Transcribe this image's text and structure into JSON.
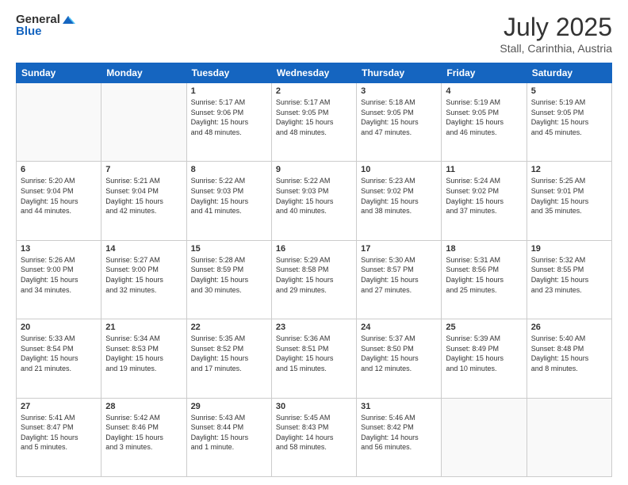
{
  "header": {
    "logo_general": "General",
    "logo_blue": "Blue",
    "month_year": "July 2025",
    "location": "Stall, Carinthia, Austria"
  },
  "weekdays": [
    "Sunday",
    "Monday",
    "Tuesday",
    "Wednesday",
    "Thursday",
    "Friday",
    "Saturday"
  ],
  "weeks": [
    [
      {
        "day": "",
        "info": ""
      },
      {
        "day": "",
        "info": ""
      },
      {
        "day": "1",
        "info": "Sunrise: 5:17 AM\nSunset: 9:06 PM\nDaylight: 15 hours\nand 48 minutes."
      },
      {
        "day": "2",
        "info": "Sunrise: 5:17 AM\nSunset: 9:05 PM\nDaylight: 15 hours\nand 48 minutes."
      },
      {
        "day": "3",
        "info": "Sunrise: 5:18 AM\nSunset: 9:05 PM\nDaylight: 15 hours\nand 47 minutes."
      },
      {
        "day": "4",
        "info": "Sunrise: 5:19 AM\nSunset: 9:05 PM\nDaylight: 15 hours\nand 46 minutes."
      },
      {
        "day": "5",
        "info": "Sunrise: 5:19 AM\nSunset: 9:05 PM\nDaylight: 15 hours\nand 45 minutes."
      }
    ],
    [
      {
        "day": "6",
        "info": "Sunrise: 5:20 AM\nSunset: 9:04 PM\nDaylight: 15 hours\nand 44 minutes."
      },
      {
        "day": "7",
        "info": "Sunrise: 5:21 AM\nSunset: 9:04 PM\nDaylight: 15 hours\nand 42 minutes."
      },
      {
        "day": "8",
        "info": "Sunrise: 5:22 AM\nSunset: 9:03 PM\nDaylight: 15 hours\nand 41 minutes."
      },
      {
        "day": "9",
        "info": "Sunrise: 5:22 AM\nSunset: 9:03 PM\nDaylight: 15 hours\nand 40 minutes."
      },
      {
        "day": "10",
        "info": "Sunrise: 5:23 AM\nSunset: 9:02 PM\nDaylight: 15 hours\nand 38 minutes."
      },
      {
        "day": "11",
        "info": "Sunrise: 5:24 AM\nSunset: 9:02 PM\nDaylight: 15 hours\nand 37 minutes."
      },
      {
        "day": "12",
        "info": "Sunrise: 5:25 AM\nSunset: 9:01 PM\nDaylight: 15 hours\nand 35 minutes."
      }
    ],
    [
      {
        "day": "13",
        "info": "Sunrise: 5:26 AM\nSunset: 9:00 PM\nDaylight: 15 hours\nand 34 minutes."
      },
      {
        "day": "14",
        "info": "Sunrise: 5:27 AM\nSunset: 9:00 PM\nDaylight: 15 hours\nand 32 minutes."
      },
      {
        "day": "15",
        "info": "Sunrise: 5:28 AM\nSunset: 8:59 PM\nDaylight: 15 hours\nand 30 minutes."
      },
      {
        "day": "16",
        "info": "Sunrise: 5:29 AM\nSunset: 8:58 PM\nDaylight: 15 hours\nand 29 minutes."
      },
      {
        "day": "17",
        "info": "Sunrise: 5:30 AM\nSunset: 8:57 PM\nDaylight: 15 hours\nand 27 minutes."
      },
      {
        "day": "18",
        "info": "Sunrise: 5:31 AM\nSunset: 8:56 PM\nDaylight: 15 hours\nand 25 minutes."
      },
      {
        "day": "19",
        "info": "Sunrise: 5:32 AM\nSunset: 8:55 PM\nDaylight: 15 hours\nand 23 minutes."
      }
    ],
    [
      {
        "day": "20",
        "info": "Sunrise: 5:33 AM\nSunset: 8:54 PM\nDaylight: 15 hours\nand 21 minutes."
      },
      {
        "day": "21",
        "info": "Sunrise: 5:34 AM\nSunset: 8:53 PM\nDaylight: 15 hours\nand 19 minutes."
      },
      {
        "day": "22",
        "info": "Sunrise: 5:35 AM\nSunset: 8:52 PM\nDaylight: 15 hours\nand 17 minutes."
      },
      {
        "day": "23",
        "info": "Sunrise: 5:36 AM\nSunset: 8:51 PM\nDaylight: 15 hours\nand 15 minutes."
      },
      {
        "day": "24",
        "info": "Sunrise: 5:37 AM\nSunset: 8:50 PM\nDaylight: 15 hours\nand 12 minutes."
      },
      {
        "day": "25",
        "info": "Sunrise: 5:39 AM\nSunset: 8:49 PM\nDaylight: 15 hours\nand 10 minutes."
      },
      {
        "day": "26",
        "info": "Sunrise: 5:40 AM\nSunset: 8:48 PM\nDaylight: 15 hours\nand 8 minutes."
      }
    ],
    [
      {
        "day": "27",
        "info": "Sunrise: 5:41 AM\nSunset: 8:47 PM\nDaylight: 15 hours\nand 5 minutes."
      },
      {
        "day": "28",
        "info": "Sunrise: 5:42 AM\nSunset: 8:46 PM\nDaylight: 15 hours\nand 3 minutes."
      },
      {
        "day": "29",
        "info": "Sunrise: 5:43 AM\nSunset: 8:44 PM\nDaylight: 15 hours\nand 1 minute."
      },
      {
        "day": "30",
        "info": "Sunrise: 5:45 AM\nSunset: 8:43 PM\nDaylight: 14 hours\nand 58 minutes."
      },
      {
        "day": "31",
        "info": "Sunrise: 5:46 AM\nSunset: 8:42 PM\nDaylight: 14 hours\nand 56 minutes."
      },
      {
        "day": "",
        "info": ""
      },
      {
        "day": "",
        "info": ""
      }
    ]
  ]
}
